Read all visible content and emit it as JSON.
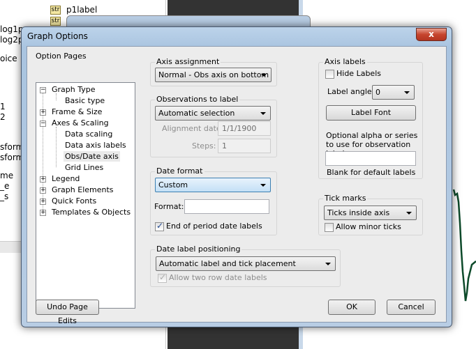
{
  "background": {
    "items": [
      "p1label",
      "log1p",
      "log2p",
      "oice",
      "1",
      "2",
      "sform",
      "sform",
      "me",
      "_e",
      "_s"
    ],
    "str_badge": "str"
  },
  "dialog": {
    "title": "Graph Options",
    "close_label": "x"
  },
  "option_pages": {
    "label": "Option Pages",
    "tree": [
      {
        "label": "Graph Type",
        "expander": "−",
        "level": 0
      },
      {
        "label": "Basic type",
        "level": 1
      },
      {
        "label": "Frame & Size",
        "expander": "+",
        "level": 0
      },
      {
        "label": "Axes & Scaling",
        "expander": "−",
        "level": 0
      },
      {
        "label": "Data scaling",
        "level": 1
      },
      {
        "label": "Data axis labels",
        "level": 1
      },
      {
        "label": "Obs/Date axis",
        "level": 1,
        "selected": true
      },
      {
        "label": "Grid Lines",
        "level": 1
      },
      {
        "label": "Legend",
        "expander": "+",
        "level": 0
      },
      {
        "label": "Graph Elements",
        "expander": "+",
        "level": 0
      },
      {
        "label": "Quick Fonts",
        "expander": "+",
        "level": 0
      },
      {
        "label": "Templates & Objects",
        "expander": "+",
        "level": 0
      }
    ]
  },
  "axis_assignment": {
    "label": "Axis assignment",
    "value": "Normal - Obs axis on bottom"
  },
  "observations": {
    "label": "Observations to label",
    "value": "Automatic selection",
    "alignment_label": "Alignment date:",
    "alignment_value": "1/1/1900",
    "steps_label": "Steps:",
    "steps_value": "1"
  },
  "date_format": {
    "label": "Date format",
    "value": "Custom",
    "format_label": "Format:",
    "format_value": "",
    "end_of_period_label": "End of period date labels",
    "end_of_period_checked": true
  },
  "date_positioning": {
    "label": "Date label positioning",
    "value": "Automatic label and tick placement",
    "two_row_label": "Allow two row date labels",
    "two_row_checked": true
  },
  "axis_labels": {
    "label": "Axis labels",
    "hide_labels": "Hide Labels",
    "hide_checked": false,
    "angle_label": "Label angle:",
    "angle_value": "0",
    "font_button": "Label Font",
    "optional_text": "Optional alpha or series to use for observation labels",
    "optional_value": "",
    "blank_hint": "Blank for default labels"
  },
  "tick_marks": {
    "label": "Tick marks",
    "value": "Ticks inside axis",
    "minor_label": "Allow minor ticks",
    "minor_checked": false
  },
  "buttons": {
    "undo": "Undo Page Edits",
    "ok": "OK",
    "cancel": "Cancel"
  },
  "colors": {
    "series_line": "#0d4a2a",
    "title_bar": "#a9c4e0",
    "close": "#c6452e"
  }
}
